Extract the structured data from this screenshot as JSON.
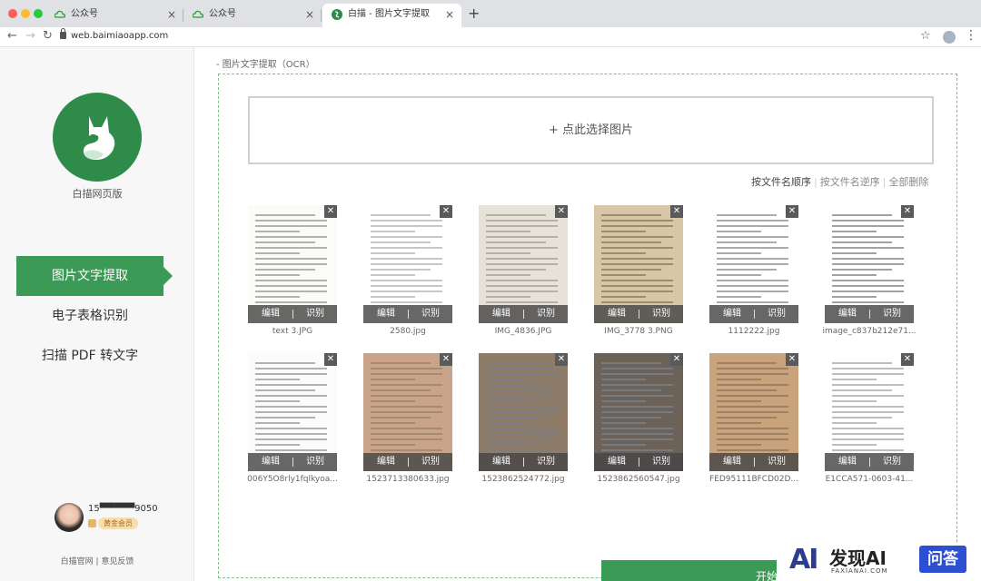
{
  "browser": {
    "tabs": [
      {
        "title": "公众号",
        "active": false
      },
      {
        "title": "公众号",
        "active": false
      },
      {
        "title": "白描 - 图片文字提取（OCR）",
        "active": true
      }
    ],
    "new_tab": "+",
    "url": "web.baimiaoapp.com"
  },
  "sidebar": {
    "logo_caption": "白描网页版",
    "menu": [
      {
        "label": "图片文字提取",
        "active": true
      },
      {
        "label": "电子表格识别",
        "active": false
      },
      {
        "label": "扫描 PDF 转文字",
        "active": false
      }
    ],
    "user_phone": "15▀▀▀▀▀9050",
    "vip_label": "黄金会员",
    "footer": "白描官网 | 意见反馈"
  },
  "main": {
    "page_title": "- 图片文字提取（OCR）",
    "select_label": "+ 点此选择图片",
    "sort": {
      "by_name": "按文件名顺序",
      "by_name_desc": "按文件名逆序",
      "delete_all": "全部删除"
    },
    "edit_label": "编辑",
    "recognize_label": "识别",
    "close_label": "✕",
    "start_label": "开始识别",
    "files": [
      {
        "name": "text 3.JPG",
        "bg": "#fbfbf8",
        "ink": "#777"
      },
      {
        "name": "2580.jpg",
        "bg": "#ffffff",
        "ink": "#999"
      },
      {
        "name": "IMG_4836.JPG",
        "bg": "#e6e2d8",
        "ink": "#8a8a80"
      },
      {
        "name": "IMG_3778 3.PNG",
        "bg": "#d7c7a6",
        "ink": "#6e5d40"
      },
      {
        "name": "1112222.jpg",
        "bg": "#ffffff",
        "ink": "#666"
      },
      {
        "name": "image_c837b212e71...",
        "bg": "#ffffff",
        "ink": "#555"
      },
      {
        "name": "006Y5O8rly1fqlkyoa...",
        "bg": "#fbfbfb",
        "ink": "#777"
      },
      {
        "name": "1523713380633.jpg",
        "bg": "#c9a488",
        "ink": "#8b7563"
      },
      {
        "name": "1523862524772.jpg",
        "bg": "#8e7c68",
        "ink": "#6f7f92"
      },
      {
        "name": "1523862560547.jpg",
        "bg": "#6d6258",
        "ink": "#7a8fa8"
      },
      {
        "name": "FED95111BFCD02D...",
        "bg": "#c9a37c",
        "ink": "#7a6550"
      },
      {
        "name": "E1CCA571-0603-41...",
        "bg": "#ffffff",
        "ink": "#888"
      }
    ]
  },
  "watermark": {
    "mark": "AI",
    "text": "发现AI",
    "sub": "FAXIANAI.COM",
    "box": "问答"
  },
  "colors": {
    "brand_green": "#3b9a55",
    "logo_green": "#2e8b4a"
  }
}
